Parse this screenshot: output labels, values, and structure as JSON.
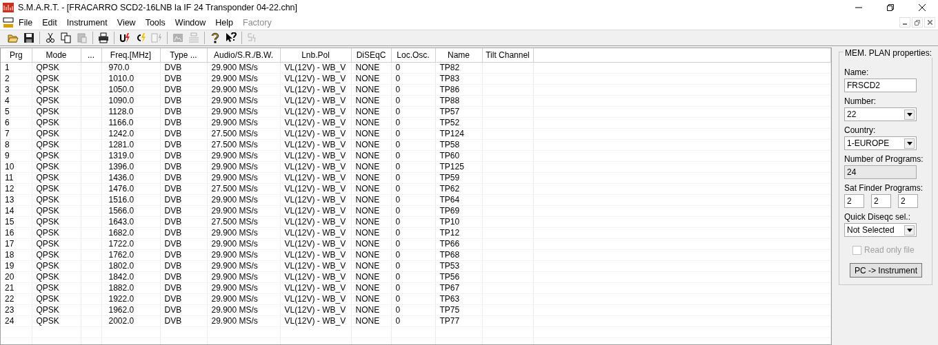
{
  "window": {
    "title": "S.M.A.R.T. - [FRACARRO SCD2-16LNB la IF 24 Transponder 04-22.chn]"
  },
  "menu": [
    {
      "label": "File",
      "disabled": false
    },
    {
      "label": "Edit",
      "disabled": false
    },
    {
      "label": "Instrument",
      "disabled": false
    },
    {
      "label": "View",
      "disabled": false
    },
    {
      "label": "Tools",
      "disabled": false
    },
    {
      "label": "Window",
      "disabled": false
    },
    {
      "label": "Help",
      "disabled": false
    },
    {
      "label": "Factory",
      "disabled": true
    }
  ],
  "toolbar": [
    {
      "kind": "open",
      "disabled": false
    },
    {
      "kind": "save",
      "disabled": false
    },
    {
      "kind": "separator"
    },
    {
      "kind": "cut",
      "disabled": false
    },
    {
      "kind": "copy",
      "disabled": false
    },
    {
      "kind": "paste",
      "disabled": true
    },
    {
      "kind": "separator"
    },
    {
      "kind": "print",
      "disabled": false
    },
    {
      "kind": "separator"
    },
    {
      "kind": "u-send",
      "disabled": false
    },
    {
      "kind": "c-send",
      "disabled": false
    },
    {
      "kind": "doc-send",
      "disabled": true
    },
    {
      "kind": "separator"
    },
    {
      "kind": "chart",
      "disabled": true
    },
    {
      "kind": "list",
      "disabled": true
    },
    {
      "kind": "separator"
    },
    {
      "kind": "help",
      "disabled": false
    },
    {
      "kind": "whats-this",
      "disabled": false
    },
    {
      "kind": "separator"
    },
    {
      "kind": "sn",
      "disabled": true
    }
  ],
  "table": {
    "columns": [
      "Prg",
      "Mode",
      "...",
      "Freq.[MHz]",
      "Type ...",
      "Audio/S.R./B.W.",
      "Lnb.Pol",
      "DiSEqC",
      "Loc.Osc.",
      "Name",
      "Tilt Channel"
    ],
    "rows": [
      [
        "1",
        "QPSK",
        "",
        "970.0",
        "DVB",
        "29.900  MS/s",
        "VL(12V) - WB_V",
        "NONE",
        "0",
        "TP82",
        ""
      ],
      [
        "2",
        "QPSK",
        "",
        "1010.0",
        "DVB",
        "29.900  MS/s",
        "VL(12V) - WB_V",
        "NONE",
        "0",
        "TP83",
        ""
      ],
      [
        "3",
        "QPSK",
        "",
        "1050.0",
        "DVB",
        "29.900  MS/s",
        "VL(12V) - WB_V",
        "NONE",
        "0",
        "TP86",
        ""
      ],
      [
        "4",
        "QPSK",
        "",
        "1090.0",
        "DVB",
        "29.900  MS/s",
        "VL(12V) - WB_V",
        "NONE",
        "0",
        "TP88",
        ""
      ],
      [
        "5",
        "QPSK",
        "",
        "1128.0",
        "DVB",
        "29.900  MS/s",
        "VL(12V) - WB_V",
        "NONE",
        "0",
        "TP57",
        ""
      ],
      [
        "6",
        "QPSK",
        "",
        "1166.0",
        "DVB",
        "29.900  MS/s",
        "VL(12V) - WB_V",
        "NONE",
        "0",
        "TP52",
        ""
      ],
      [
        "7",
        "QPSK",
        "",
        "1242.0",
        "DVB",
        "27.500  MS/s",
        "VL(12V) - WB_V",
        "NONE",
        "0",
        "TP124",
        ""
      ],
      [
        "8",
        "QPSK",
        "",
        "1281.0",
        "DVB",
        "27.500  MS/s",
        "VL(12V) - WB_V",
        "NONE",
        "0",
        "TP58",
        ""
      ],
      [
        "9",
        "QPSK",
        "",
        "1319.0",
        "DVB",
        "29.900  MS/s",
        "VL(12V) - WB_V",
        "NONE",
        "0",
        "TP60",
        ""
      ],
      [
        "10",
        "QPSK",
        "",
        "1396.0",
        "DVB",
        "29.900  MS/s",
        "VL(12V) - WB_V",
        "NONE",
        "0",
        "TP125",
        ""
      ],
      [
        "11",
        "QPSK",
        "",
        "1436.0",
        "DVB",
        "29.900  MS/s",
        "VL(12V) - WB_V",
        "NONE",
        "0",
        "TP59",
        ""
      ],
      [
        "12",
        "QPSK",
        "",
        "1476.0",
        "DVB",
        "27.500  MS/s",
        "VL(12V) - WB_V",
        "NONE",
        "0",
        "TP62",
        ""
      ],
      [
        "13",
        "QPSK",
        "",
        "1516.0",
        "DVB",
        "29.900  MS/s",
        "VL(12V) - WB_V",
        "NONE",
        "0",
        "TP64",
        ""
      ],
      [
        "14",
        "QPSK",
        "",
        "1566.0",
        "DVB",
        "29.900  MS/s",
        "VL(12V) - WB_V",
        "NONE",
        "0",
        "TP69",
        ""
      ],
      [
        "15",
        "QPSK",
        "",
        "1643.0",
        "DVB",
        "27.500  MS/s",
        "VL(12V) - WB_V",
        "NONE",
        "0",
        "TP10",
        ""
      ],
      [
        "16",
        "QPSK",
        "",
        "1682.0",
        "DVB",
        "29.900  MS/s",
        "VL(12V) - WB_V",
        "NONE",
        "0",
        "TP12",
        ""
      ],
      [
        "17",
        "QPSK",
        "",
        "1722.0",
        "DVB",
        "29.900  MS/s",
        "VL(12V) - WB_V",
        "NONE",
        "0",
        "TP66",
        ""
      ],
      [
        "18",
        "QPSK",
        "",
        "1762.0",
        "DVB",
        "29.900  MS/s",
        "VL(12V) - WB_V",
        "NONE",
        "0",
        "TP68",
        ""
      ],
      [
        "19",
        "QPSK",
        "",
        "1802.0",
        "DVB",
        "29.900  MS/s",
        "VL(12V) - WB_V",
        "NONE",
        "0",
        "TP53",
        ""
      ],
      [
        "20",
        "QPSK",
        "",
        "1842.0",
        "DVB",
        "29.900  MS/s",
        "VL(12V) - WB_V",
        "NONE",
        "0",
        "TP56",
        ""
      ],
      [
        "21",
        "QPSK",
        "",
        "1882.0",
        "DVB",
        "29.900  MS/s",
        "VL(12V) - WB_V",
        "NONE",
        "0",
        "TP67",
        ""
      ],
      [
        "22",
        "QPSK",
        "",
        "1922.0",
        "DVB",
        "29.900  MS/s",
        "VL(12V) - WB_V",
        "NONE",
        "0",
        "TP63",
        ""
      ],
      [
        "23",
        "QPSK",
        "",
        "1962.0",
        "DVB",
        "29.900  MS/s",
        "VL(12V) - WB_V",
        "NONE",
        "0",
        "TP75",
        ""
      ],
      [
        "24",
        "QPSK",
        "",
        "2002.0",
        "DVB",
        "29.900  MS/s",
        "VL(12V) - WB_V",
        "NONE",
        "0",
        "TP77",
        ""
      ]
    ]
  },
  "properties": {
    "title": "MEM. PLAN properties:",
    "fields": [
      {
        "kind": "text",
        "label": "Name:",
        "value": "FRSCD2"
      },
      {
        "kind": "select",
        "label": "Number:",
        "value": "22"
      },
      {
        "kind": "select",
        "label": "Country:",
        "value": "1-EUROPE"
      },
      {
        "kind": "readonly",
        "label": "Number of Programs:",
        "value": "24"
      },
      {
        "kind": "triple",
        "label": "Sat Finder Programs:",
        "values": [
          "2",
          "2",
          "2"
        ]
      },
      {
        "kind": "select",
        "label": "Quick Diseqc sel.:",
        "value": "Not Selected"
      }
    ],
    "read_only": {
      "label": "Read only file",
      "checked": false,
      "disabled": true
    },
    "button": "PC -> Instrument"
  }
}
